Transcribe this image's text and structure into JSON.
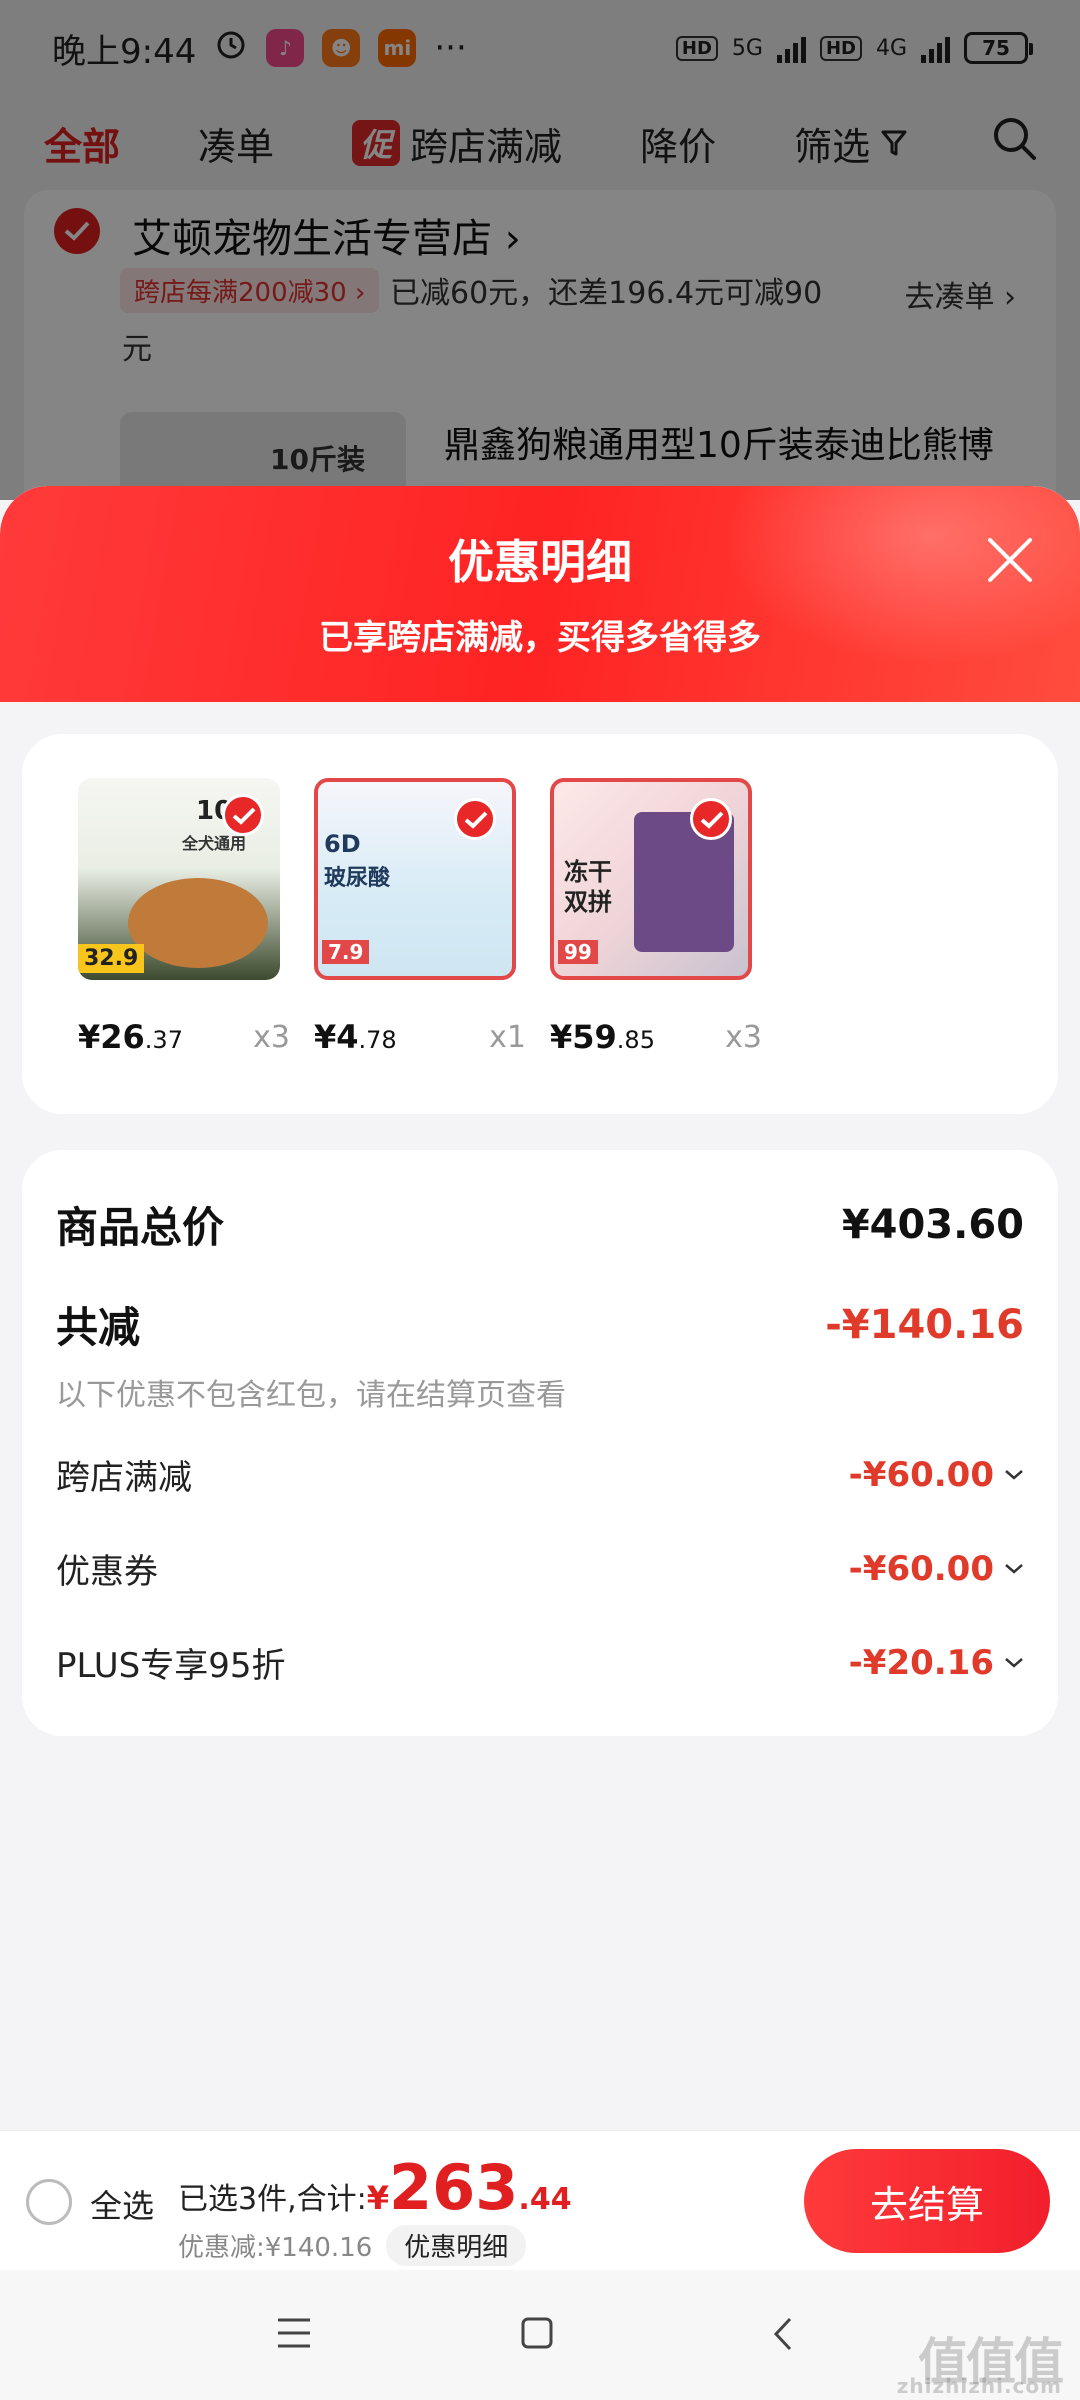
{
  "status_bar": {
    "time": "晚上9:44",
    "hd1": "HD",
    "net1": "5G",
    "hd2": "HD",
    "net2": "4G",
    "battery": "75"
  },
  "top_tabs": {
    "all": "全部",
    "combine": "凑单",
    "promo_badge": "促",
    "cross_store": "跨店满减",
    "price_drop": "降价",
    "filter": "筛选"
  },
  "store": {
    "name": "艾顿宠物生活专营店 ›",
    "promo_tag": "跨店每满200减30 ›",
    "promo_desc": "已减60元，还差196.4元可减90元",
    "goto": "去凑单 ›",
    "item_title": "鼎鑫狗粮通用型10斤装泰迪比熊博",
    "item_thumb_text": "10斤装"
  },
  "sheet": {
    "title": "优惠明细",
    "subtitle": "已享跨店满减，买得多省得多"
  },
  "products": [
    {
      "price_int": "¥26",
      "price_dec": ".37",
      "qty": "x3",
      "img_text_a": "10",
      "img_text_b": "全犬通用",
      "img_text_c": "32.9"
    },
    {
      "price_int": "¥4",
      "price_dec": ".78",
      "qty": "x1",
      "img_text_a": "6D",
      "img_text_b": "玻尿酸",
      "img_text_c": "7.9"
    },
    {
      "price_int": "¥59",
      "price_dec": ".85",
      "qty": "x3",
      "img_text_a": "冻干",
      "img_text_b": "双拼",
      "img_text_c": "99"
    }
  ],
  "summary": {
    "total_label": "商品总价",
    "total_value": "¥403.60",
    "reduce_label": "共减",
    "reduce_value": "-¥140.16",
    "note": "以下优惠不包含红包，请在结算页查看",
    "items": [
      {
        "label": "跨店满减",
        "value": "-¥60.00"
      },
      {
        "label": "优惠券",
        "value": "-¥60.00"
      },
      {
        "label": "PLUS专享95折",
        "value": "-¥20.16"
      }
    ]
  },
  "bottom": {
    "select_all": "全选",
    "selected_prefix": "已选3件,合计:",
    "currency": "¥",
    "total_int": "263",
    "total_dec": ".44",
    "discount": "优惠减:¥140.16",
    "detail_btn": "优惠明细",
    "checkout": "去结算"
  },
  "watermark": {
    "main": "值值值",
    "sub": "zhizhizhi.com"
  },
  "colors": {
    "accent": "#e02020",
    "sheet_header": "#ff2d2d"
  }
}
